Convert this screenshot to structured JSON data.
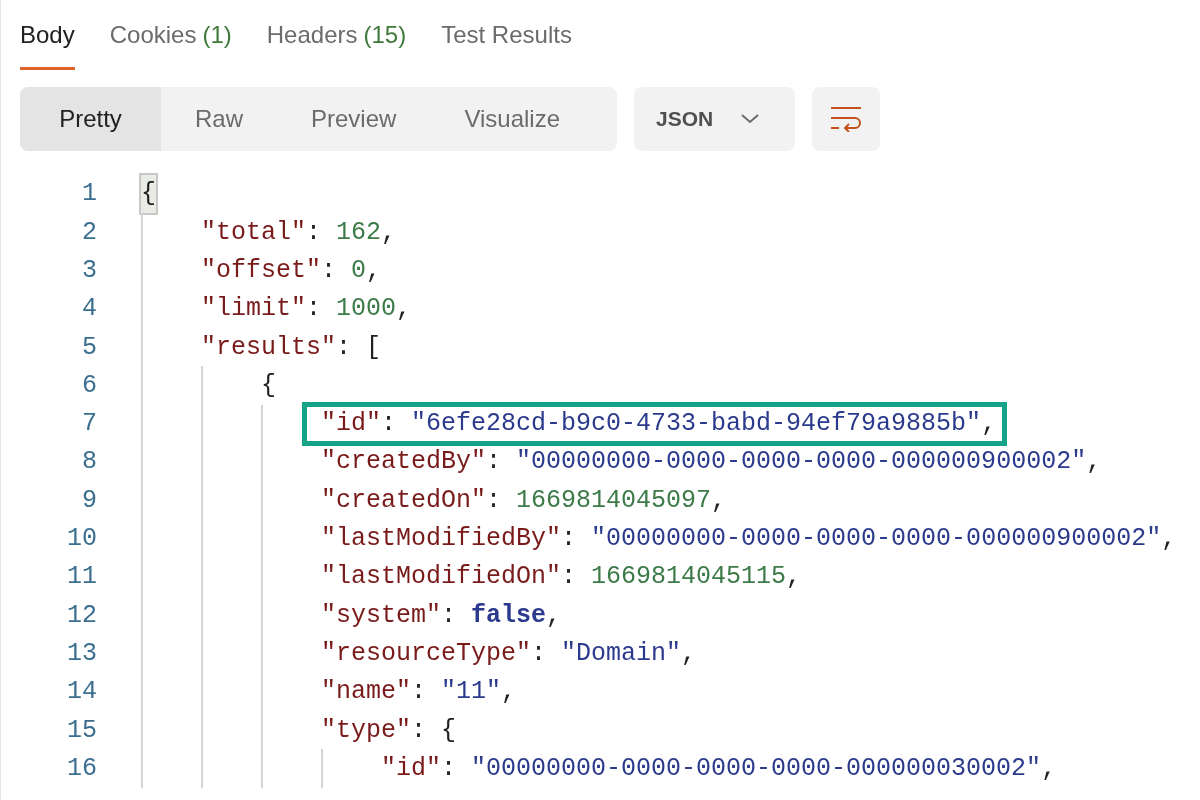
{
  "tabs": [
    {
      "label": "Body",
      "selected": true
    },
    {
      "label": "Cookies",
      "count": "(1)",
      "selected": false
    },
    {
      "label": "Headers",
      "count": "(15)",
      "selected": false
    },
    {
      "label": "Test Results",
      "selected": false
    }
  ],
  "view_modes": [
    {
      "label": "Pretty",
      "selected": true
    },
    {
      "label": "Raw",
      "selected": false
    },
    {
      "label": "Preview",
      "selected": false
    },
    {
      "label": "Visualize",
      "selected": false
    }
  ],
  "format_dropdown": {
    "value": "JSON"
  },
  "code": [
    {
      "number": "1",
      "matched": true,
      "highlighted": false,
      "tokens": [
        {
          "kind": "punct",
          "text": "{"
        }
      ],
      "children": [
        {
          "number": "2",
          "matched": false,
          "highlighted": false,
          "tokens": [
            {
              "kind": "key",
              "text": "\"total\""
            },
            {
              "kind": "punct",
              "text": ": "
            },
            {
              "kind": "number",
              "text": "162"
            },
            {
              "kind": "punct",
              "text": ","
            }
          ]
        },
        {
          "number": "3",
          "matched": false,
          "highlighted": false,
          "tokens": [
            {
              "kind": "key",
              "text": "\"offset\""
            },
            {
              "kind": "punct",
              "text": ": "
            },
            {
              "kind": "number",
              "text": "0"
            },
            {
              "kind": "punct",
              "text": ","
            }
          ]
        },
        {
          "number": "4",
          "matched": false,
          "highlighted": false,
          "tokens": [
            {
              "kind": "key",
              "text": "\"limit\""
            },
            {
              "kind": "punct",
              "text": ": "
            },
            {
              "kind": "number",
              "text": "1000"
            },
            {
              "kind": "punct",
              "text": ","
            }
          ]
        },
        {
          "number": "5",
          "matched": false,
          "highlighted": false,
          "tokens": [
            {
              "kind": "key",
              "text": "\"results\""
            },
            {
              "kind": "punct",
              "text": ": ["
            }
          ],
          "children": [
            {
              "number": "6",
              "matched": false,
              "highlighted": false,
              "tokens": [
                {
                  "kind": "punct",
                  "text": "{"
                }
              ],
              "children": [
                {
                  "number": "7",
                  "matched": false,
                  "highlighted": true,
                  "tokens": [
                    {
                      "kind": "key",
                      "text": "\"id\""
                    },
                    {
                      "kind": "punct",
                      "text": ": "
                    },
                    {
                      "kind": "string",
                      "text": "\"6efe28cd-b9c0-4733-babd-94ef79a9885b\""
                    },
                    {
                      "kind": "punct",
                      "text": ","
                    }
                  ]
                },
                {
                  "number": "8",
                  "matched": false,
                  "highlighted": false,
                  "tokens": [
                    {
                      "kind": "key",
                      "text": "\"createdBy\""
                    },
                    {
                      "kind": "punct",
                      "text": ": "
                    },
                    {
                      "kind": "string",
                      "text": "\"00000000-0000-0000-0000-000000900002\""
                    },
                    {
                      "kind": "punct",
                      "text": ","
                    }
                  ]
                },
                {
                  "number": "9",
                  "matched": false,
                  "highlighted": false,
                  "tokens": [
                    {
                      "kind": "key",
                      "text": "\"createdOn\""
                    },
                    {
                      "kind": "punct",
                      "text": ": "
                    },
                    {
                      "kind": "number",
                      "text": "1669814045097"
                    },
                    {
                      "kind": "punct",
                      "text": ","
                    }
                  ]
                },
                {
                  "number": "10",
                  "matched": false,
                  "highlighted": false,
                  "tokens": [
                    {
                      "kind": "key",
                      "text": "\"lastModifiedBy\""
                    },
                    {
                      "kind": "punct",
                      "text": ": "
                    },
                    {
                      "kind": "string",
                      "text": "\"00000000-0000-0000-0000-000000900002\""
                    },
                    {
                      "kind": "punct",
                      "text": ","
                    }
                  ]
                },
                {
                  "number": "11",
                  "matched": false,
                  "highlighted": false,
                  "tokens": [
                    {
                      "kind": "key",
                      "text": "\"lastModifiedOn\""
                    },
                    {
                      "kind": "punct",
                      "text": ": "
                    },
                    {
                      "kind": "number",
                      "text": "1669814045115"
                    },
                    {
                      "kind": "punct",
                      "text": ","
                    }
                  ]
                },
                {
                  "number": "12",
                  "matched": false,
                  "highlighted": false,
                  "tokens": [
                    {
                      "kind": "key",
                      "text": "\"system\""
                    },
                    {
                      "kind": "punct",
                      "text": ": "
                    },
                    {
                      "kind": "boolean",
                      "text": "false"
                    },
                    {
                      "kind": "punct",
                      "text": ","
                    }
                  ]
                },
                {
                  "number": "13",
                  "matched": false,
                  "highlighted": false,
                  "tokens": [
                    {
                      "kind": "key",
                      "text": "\"resourceType\""
                    },
                    {
                      "kind": "punct",
                      "text": ": "
                    },
                    {
                      "kind": "string",
                      "text": "\"Domain\""
                    },
                    {
                      "kind": "punct",
                      "text": ","
                    }
                  ]
                },
                {
                  "number": "14",
                  "matched": false,
                  "highlighted": false,
                  "tokens": [
                    {
                      "kind": "key",
                      "text": "\"name\""
                    },
                    {
                      "kind": "punct",
                      "text": ": "
                    },
                    {
                      "kind": "string",
                      "text": "\"11\""
                    },
                    {
                      "kind": "punct",
                      "text": ","
                    }
                  ]
                },
                {
                  "number": "15",
                  "matched": false,
                  "highlighted": false,
                  "tokens": [
                    {
                      "kind": "key",
                      "text": "\"type\""
                    },
                    {
                      "kind": "punct",
                      "text": ": {"
                    }
                  ],
                  "children": [
                    {
                      "number": "16",
                      "matched": false,
                      "highlighted": false,
                      "tokens": [
                        {
                          "kind": "key",
                          "text": "\"id\""
                        },
                        {
                          "kind": "punct",
                          "text": ": "
                        },
                        {
                          "kind": "string",
                          "text": "\"00000000-0000-0000-0000-000000030002\""
                        },
                        {
                          "kind": "punct",
                          "text": ","
                        }
                      ]
                    }
                  ]
                }
              ]
            }
          ]
        }
      ]
    }
  ]
}
